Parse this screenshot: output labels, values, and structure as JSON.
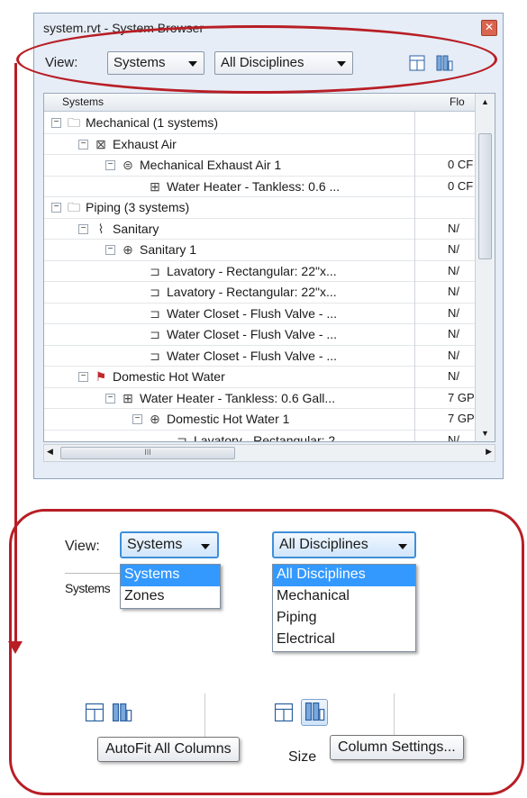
{
  "window": {
    "title": "system.rvt - System Browser",
    "close_glyph": "✕",
    "view_label": "View:",
    "view_value": "Systems",
    "discipline_value": "All Disciplines"
  },
  "grid": {
    "col_systems": "Systems",
    "col_flow": "Flo",
    "rows": [
      {
        "label": "Mechanical (1 systems)",
        "flow": "",
        "level": 0,
        "exp": "−",
        "icon": "folder-icon"
      },
      {
        "label": "Exhaust Air",
        "flow": "",
        "level": 1,
        "exp": "−",
        "icon": "exhaust-air-icon"
      },
      {
        "label": "Mechanical Exhaust Air 1",
        "flow": "0 CF",
        "level": 2,
        "exp": "−",
        "icon": "duct-system-icon"
      },
      {
        "label": "Water Heater - Tankless: 0.6 ...",
        "flow": "0 CF",
        "level": 3,
        "exp": "",
        "icon": "equipment-icon"
      },
      {
        "label": "Piping (3 systems)",
        "flow": "",
        "level": 0,
        "exp": "−",
        "icon": "folder-icon"
      },
      {
        "label": "Sanitary",
        "flow": "N/",
        "level": 1,
        "exp": "−",
        "icon": "sanitary-icon"
      },
      {
        "label": "Sanitary 1",
        "flow": "N/",
        "level": 2,
        "exp": "−",
        "icon": "pipe-system-icon"
      },
      {
        "label": "Lavatory - Rectangular: 22\"x...",
        "flow": "N/",
        "level": 3,
        "exp": "",
        "icon": "fixture-icon"
      },
      {
        "label": "Lavatory - Rectangular: 22\"x...",
        "flow": "N/",
        "level": 3,
        "exp": "",
        "icon": "fixture-icon"
      },
      {
        "label": "Water Closet - Flush Valve - ...",
        "flow": "N/",
        "level": 3,
        "exp": "",
        "icon": "fixture-icon"
      },
      {
        "label": "Water Closet - Flush Valve - ...",
        "flow": "N/",
        "level": 3,
        "exp": "",
        "icon": "fixture-icon"
      },
      {
        "label": "Water Closet - Flush Valve - ...",
        "flow": "N/",
        "level": 3,
        "exp": "",
        "icon": "fixture-icon"
      },
      {
        "label": "Domestic Hot Water",
        "flow": "N/",
        "level": 1,
        "exp": "−",
        "icon": "hot-water-icon"
      },
      {
        "label": "Water Heater - Tankless: 0.6 Gall...",
        "flow": "7 GP",
        "level": 2,
        "exp": "−",
        "icon": "equipment-icon"
      },
      {
        "label": "Domestic Hot Water 1",
        "flow": "7 GP",
        "level": 3,
        "exp": "−",
        "icon": "pipe-system-icon"
      },
      {
        "label": "Lavatory - Rectangular: 2...",
        "flow": "N/",
        "level": 4,
        "exp": "",
        "icon": "fixture-icon"
      }
    ],
    "hscroll_grip": "III"
  },
  "detail": {
    "view_label": "View:",
    "view_dropdown": "Systems",
    "view_options": [
      "Systems",
      "Zones"
    ],
    "discipline_dropdown": "All Disciplines",
    "discipline_options": [
      "All Disciplines",
      "Mechanical",
      "Piping",
      "Electrical"
    ],
    "behind_label": "Systems",
    "tooltip_autofit": "AutoFit All Columns",
    "tooltip_settings": "Column Settings...",
    "size_label": "Size"
  },
  "colors": {
    "annotation": "#b81e25",
    "selection": "#3399ff"
  }
}
